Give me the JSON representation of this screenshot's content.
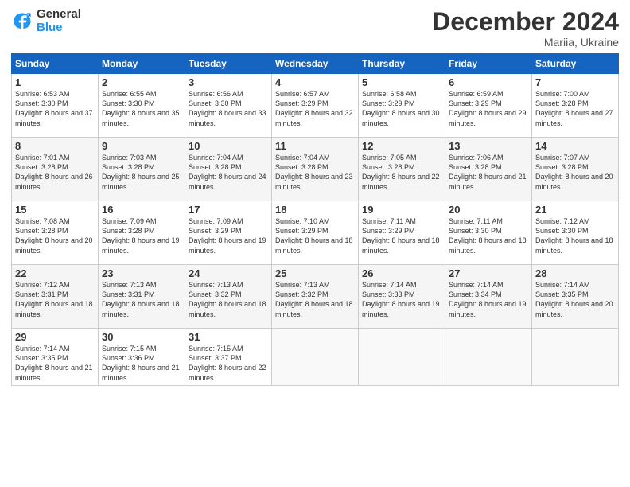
{
  "logo": {
    "general": "General",
    "blue": "Blue"
  },
  "title": "December 2024",
  "subtitle": "Mariia, Ukraine",
  "days_header": [
    "Sunday",
    "Monday",
    "Tuesday",
    "Wednesday",
    "Thursday",
    "Friday",
    "Saturday"
  ],
  "weeks": [
    [
      {
        "day": "1",
        "sunrise": "6:53 AM",
        "sunset": "3:30 PM",
        "daylight": "8 hours and 37 minutes."
      },
      {
        "day": "2",
        "sunrise": "6:55 AM",
        "sunset": "3:30 PM",
        "daylight": "8 hours and 35 minutes."
      },
      {
        "day": "3",
        "sunrise": "6:56 AM",
        "sunset": "3:30 PM",
        "daylight": "8 hours and 33 minutes."
      },
      {
        "day": "4",
        "sunrise": "6:57 AM",
        "sunset": "3:29 PM",
        "daylight": "8 hours and 32 minutes."
      },
      {
        "day": "5",
        "sunrise": "6:58 AM",
        "sunset": "3:29 PM",
        "daylight": "8 hours and 30 minutes."
      },
      {
        "day": "6",
        "sunrise": "6:59 AM",
        "sunset": "3:29 PM",
        "daylight": "8 hours and 29 minutes."
      },
      {
        "day": "7",
        "sunrise": "7:00 AM",
        "sunset": "3:28 PM",
        "daylight": "8 hours and 27 minutes."
      }
    ],
    [
      {
        "day": "8",
        "sunrise": "7:01 AM",
        "sunset": "3:28 PM",
        "daylight": "8 hours and 26 minutes."
      },
      {
        "day": "9",
        "sunrise": "7:03 AM",
        "sunset": "3:28 PM",
        "daylight": "8 hours and 25 minutes."
      },
      {
        "day": "10",
        "sunrise": "7:04 AM",
        "sunset": "3:28 PM",
        "daylight": "8 hours and 24 minutes."
      },
      {
        "day": "11",
        "sunrise": "7:04 AM",
        "sunset": "3:28 PM",
        "daylight": "8 hours and 23 minutes."
      },
      {
        "day": "12",
        "sunrise": "7:05 AM",
        "sunset": "3:28 PM",
        "daylight": "8 hours and 22 minutes."
      },
      {
        "day": "13",
        "sunrise": "7:06 AM",
        "sunset": "3:28 PM",
        "daylight": "8 hours and 21 minutes."
      },
      {
        "day": "14",
        "sunrise": "7:07 AM",
        "sunset": "3:28 PM",
        "daylight": "8 hours and 20 minutes."
      }
    ],
    [
      {
        "day": "15",
        "sunrise": "7:08 AM",
        "sunset": "3:28 PM",
        "daylight": "8 hours and 20 minutes."
      },
      {
        "day": "16",
        "sunrise": "7:09 AM",
        "sunset": "3:28 PM",
        "daylight": "8 hours and 19 minutes."
      },
      {
        "day": "17",
        "sunrise": "7:09 AM",
        "sunset": "3:29 PM",
        "daylight": "8 hours and 19 minutes."
      },
      {
        "day": "18",
        "sunrise": "7:10 AM",
        "sunset": "3:29 PM",
        "daylight": "8 hours and 18 minutes."
      },
      {
        "day": "19",
        "sunrise": "7:11 AM",
        "sunset": "3:29 PM",
        "daylight": "8 hours and 18 minutes."
      },
      {
        "day": "20",
        "sunrise": "7:11 AM",
        "sunset": "3:30 PM",
        "daylight": "8 hours and 18 minutes."
      },
      {
        "day": "21",
        "sunrise": "7:12 AM",
        "sunset": "3:30 PM",
        "daylight": "8 hours and 18 minutes."
      }
    ],
    [
      {
        "day": "22",
        "sunrise": "7:12 AM",
        "sunset": "3:31 PM",
        "daylight": "8 hours and 18 minutes."
      },
      {
        "day": "23",
        "sunrise": "7:13 AM",
        "sunset": "3:31 PM",
        "daylight": "8 hours and 18 minutes."
      },
      {
        "day": "24",
        "sunrise": "7:13 AM",
        "sunset": "3:32 PM",
        "daylight": "8 hours and 18 minutes."
      },
      {
        "day": "25",
        "sunrise": "7:13 AM",
        "sunset": "3:32 PM",
        "daylight": "8 hours and 18 minutes."
      },
      {
        "day": "26",
        "sunrise": "7:14 AM",
        "sunset": "3:33 PM",
        "daylight": "8 hours and 19 minutes."
      },
      {
        "day": "27",
        "sunrise": "7:14 AM",
        "sunset": "3:34 PM",
        "daylight": "8 hours and 19 minutes."
      },
      {
        "day": "28",
        "sunrise": "7:14 AM",
        "sunset": "3:35 PM",
        "daylight": "8 hours and 20 minutes."
      }
    ],
    [
      {
        "day": "29",
        "sunrise": "7:14 AM",
        "sunset": "3:35 PM",
        "daylight": "8 hours and 21 minutes."
      },
      {
        "day": "30",
        "sunrise": "7:15 AM",
        "sunset": "3:36 PM",
        "daylight": "8 hours and 21 minutes."
      },
      {
        "day": "31",
        "sunrise": "7:15 AM",
        "sunset": "3:37 PM",
        "daylight": "8 hours and 22 minutes."
      },
      null,
      null,
      null,
      null
    ]
  ]
}
